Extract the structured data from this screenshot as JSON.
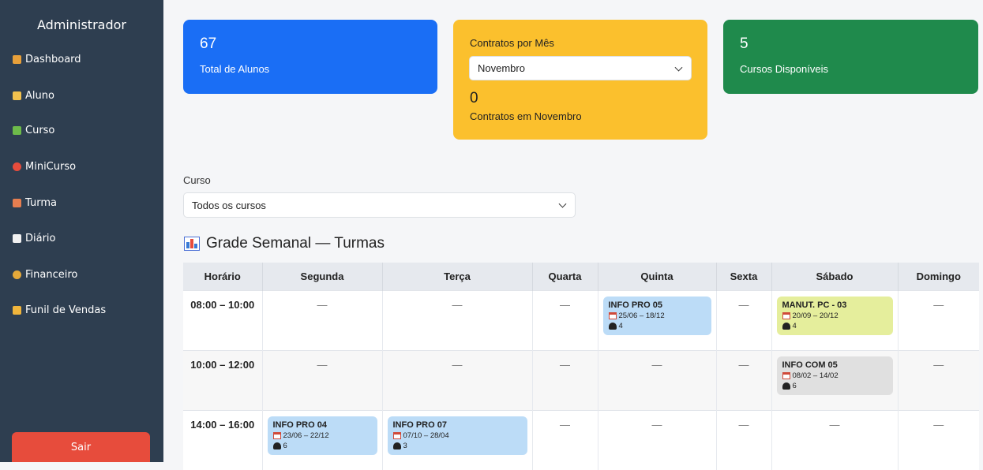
{
  "sidebar": {
    "title": "Administrador",
    "items": [
      {
        "label": "Dashboard",
        "icon": "bar-chart-icon",
        "color": "#e8a03a"
      },
      {
        "label": "Aluno",
        "icon": "student-icon",
        "color": "#f2c14e"
      },
      {
        "label": "Curso",
        "icon": "books-icon",
        "color": "#6dbb4a"
      },
      {
        "label": "MiniCurso",
        "icon": "target-icon",
        "color": "#e74c3c"
      },
      {
        "label": "Turma",
        "icon": "school-icon",
        "color": "#e67e50"
      },
      {
        "label": "Diário",
        "icon": "notepad-icon",
        "color": "#f1f1f1"
      },
      {
        "label": "Financeiro",
        "icon": "money-bag-icon",
        "color": "#e5a93a"
      },
      {
        "label": "Funil de Vendas",
        "icon": "folder-icon",
        "color": "#f0b53c"
      }
    ],
    "logout_label": "Sair"
  },
  "cards": {
    "students": {
      "value": "67",
      "label": "Total de Alunos",
      "color": "#1a6ef5"
    },
    "contracts": {
      "title": "Contratos por Mês",
      "month": "Novembro",
      "value": "0",
      "label": "Contratos em Novembro",
      "color": "#fbc02d"
    },
    "courses": {
      "value": "5",
      "label": "Cursos Disponíveis",
      "color": "#1f8a4c"
    }
  },
  "filter": {
    "label": "Curso",
    "value": "Todos os cursos"
  },
  "schedule": {
    "title": "Grade Semanal — Turmas",
    "headers": [
      "Horário",
      "Segunda",
      "Terça",
      "Quarta",
      "Quinta",
      "Sexta",
      "Sábado",
      "Domingo"
    ],
    "empty": "—",
    "rows": [
      {
        "hour": "08:00 – 10:00"
      },
      {
        "hour": "10:00 – 12:00"
      },
      {
        "hour": "14:00 – 16:00"
      }
    ],
    "slots": {
      "r0_quinta": {
        "name": "INFO PRO 05",
        "dates": "25/06 – 18/12",
        "count": "4",
        "color": "#bcdcf7"
      },
      "r0_sabado": {
        "name": "MANUT. PC - 03",
        "dates": "20/09 – 20/12",
        "count": "4",
        "color": "#e5ee9c"
      },
      "r1_sabado": {
        "name": "INFO COM 05",
        "dates": "08/02 – 14/02",
        "count": "6",
        "color": "#e0e0e0"
      },
      "r2_segunda": {
        "name": "INFO PRO 04",
        "dates": "23/06 – 22/12",
        "count": "6",
        "color": "#bcdcf7"
      },
      "r2_terca": {
        "name": "INFO PRO 07",
        "dates": "07/10 – 28/04",
        "count": "3",
        "color": "#bcdcf7"
      }
    }
  }
}
